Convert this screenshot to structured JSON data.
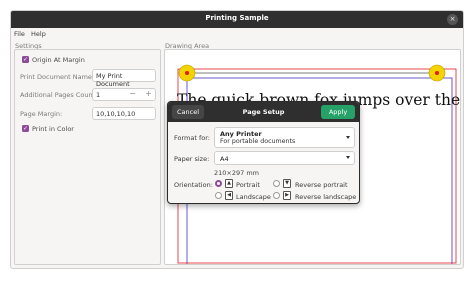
{
  "window": {
    "title": "Printing Sample",
    "close_glyph": "×"
  },
  "menu": {
    "items": [
      "File",
      "Help"
    ]
  },
  "settings": {
    "group_label": "Settings",
    "origin_at_margin": {
      "label": "Origin At Margin",
      "checked": true
    },
    "print_document_name": {
      "label": "Print Document Name:",
      "value": "My Print Document"
    },
    "additional_pages": {
      "label": "Additional Pages Count:",
      "value": "1",
      "minus": "−",
      "plus": "+"
    },
    "page_margin": {
      "label": "Page Margin:",
      "value": "10,10,10,10"
    },
    "print_in_color": {
      "label": "Print in Color",
      "checked": true
    },
    "check_glyph": "✓"
  },
  "drawing": {
    "group_label": "Drawing Area",
    "sample_text": "The quick brown fox jumps over the la",
    "accent_yellow": "#f5d300",
    "accent_red": "#e01b24",
    "line_color": "#6a5acd"
  },
  "page_setup": {
    "title": "Page Setup",
    "cancel_label": "Cancel",
    "apply_label": "Apply",
    "format_for_label": "Format for:",
    "printer_name": "Any Printer",
    "printer_desc": "For portable documents",
    "paper_size_label": "Paper size:",
    "paper_size_value": "A4",
    "paper_dims": "210×297 mm",
    "orientation_label": "Orientation:",
    "orientations": {
      "portrait": "Portrait",
      "landscape": "Landscape",
      "reverse_portrait": "Reverse portrait",
      "reverse_landscape": "Reverse landscape"
    },
    "selected_orientation": "Portrait",
    "apply_color": "#26a269"
  }
}
